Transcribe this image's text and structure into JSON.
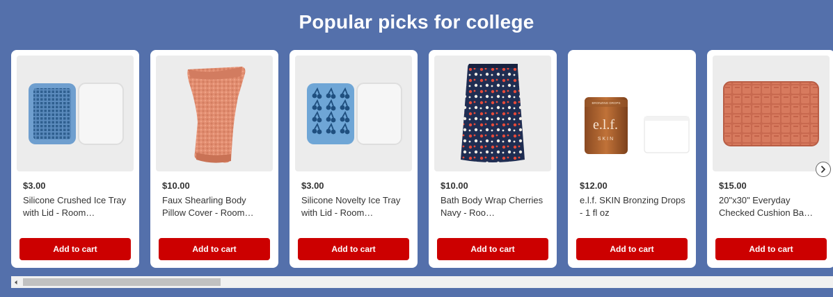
{
  "section": {
    "title": "Popular picks for college"
  },
  "products": [
    {
      "price": "$3.00",
      "name": "Silicone Crushed Ice Tray with Lid - Room…",
      "cta": "Add to cart",
      "image_icon": "ice-tray-icon"
    },
    {
      "price": "$10.00",
      "name": "Faux Shearling Body Pillow Cover - Room…",
      "cta": "Add to cart",
      "image_icon": "pillow-cover-icon"
    },
    {
      "price": "$3.00",
      "name": "Silicone Novelty Ice Tray with Lid - Room…",
      "cta": "Add to cart",
      "image_icon": "novelty-ice-tray-icon"
    },
    {
      "price": "$10.00",
      "name": "Bath Body Wrap Cherries Navy - Roo…",
      "cta": "Add to cart",
      "image_icon": "body-wrap-icon"
    },
    {
      "price": "$12.00",
      "name": "e.l.f. SKIN Bronzing Drops - 1 fl oz",
      "cta": "Add to cart",
      "image_icon": "bronzing-drops-icon",
      "brand_logo_text": "e.l.f.",
      "brand_logo_sub": "SKIN"
    },
    {
      "price": "$15.00",
      "name": "20\"x30\" Everyday Checked Cushion Ba…",
      "cta": "Add to cart",
      "image_icon": "bath-mat-icon"
    }
  ],
  "carousel": {
    "next_icon": "chevron-right-icon"
  },
  "scrollbar": {
    "left_icon": "scroll-left-arrow-icon"
  },
  "colors": {
    "background": "#5470ab",
    "button": "#cc0000",
    "card": "#ffffff"
  }
}
